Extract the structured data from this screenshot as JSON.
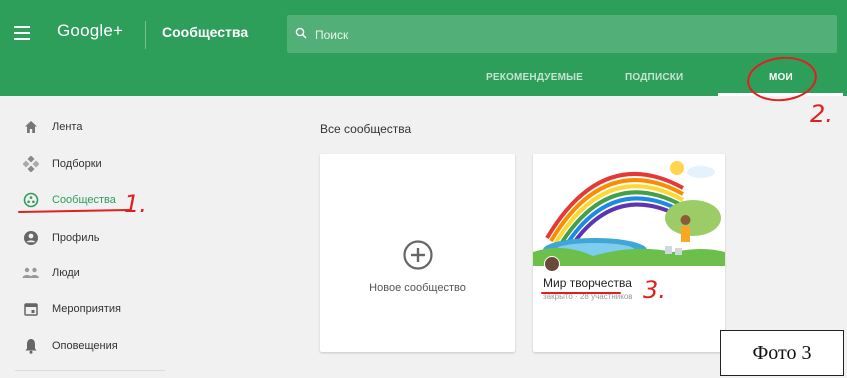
{
  "header": {
    "brand": "Google+",
    "section": "Сообщества",
    "search_placeholder": "Поиск"
  },
  "tabs": [
    {
      "label": "РЕКОМЕНДУЕМЫЕ",
      "active": false
    },
    {
      "label": "ПОДПИСКИ",
      "active": false
    },
    {
      "label": "МОИ",
      "active": true
    }
  ],
  "sidebar": {
    "items": [
      {
        "label": "Лента",
        "icon": "home-icon"
      },
      {
        "label": "Подборки",
        "icon": "collections-icon"
      },
      {
        "label": "Сообщества",
        "icon": "communities-icon",
        "active": true
      },
      {
        "label": "Профиль",
        "icon": "profile-icon"
      },
      {
        "label": "Люди",
        "icon": "people-icon"
      },
      {
        "label": "Мероприятия",
        "icon": "calendar-icon"
      },
      {
        "label": "Оповещения",
        "icon": "bell-icon"
      }
    ]
  },
  "main": {
    "heading": "Все сообщества",
    "new_community_label": "Новое сообщество",
    "community": {
      "name": "Мир творчества",
      "meta": "закрыто · 28 участников"
    }
  },
  "annotations": {
    "num1": "1.",
    "num2": "2.",
    "num3": "3."
  },
  "photo_label": "Фото 3",
  "colors": {
    "brand_green": "#2e9e5b",
    "annotation_red": "#e02020"
  }
}
